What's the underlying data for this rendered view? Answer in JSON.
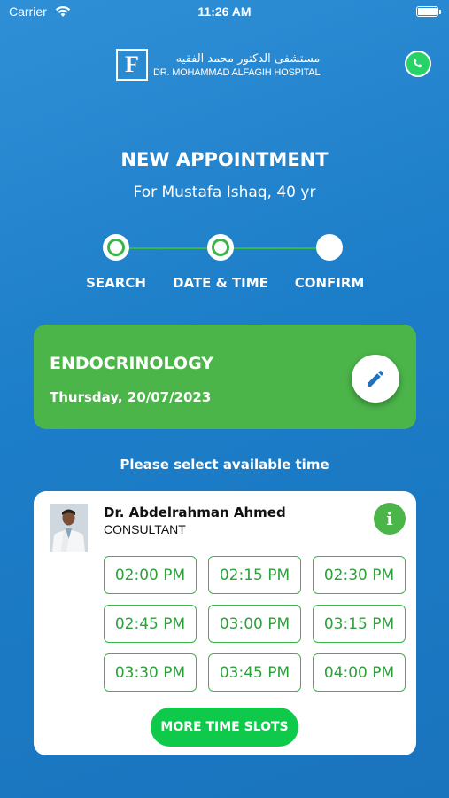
{
  "status_bar": {
    "carrier": "Carrier",
    "time": "11:26 AM"
  },
  "header": {
    "logo_arabic": "مستشفى الدكتور محمد الفقيه",
    "logo_english": "DR. MOHAMMAD ALFAGIH HOSPITAL",
    "logo_letter": "F"
  },
  "page": {
    "title": "NEW APPOINTMENT",
    "subtitle": "For Mustafa Ishaq, 40 yr"
  },
  "stepper": {
    "steps": [
      {
        "label": "SEARCH",
        "done": true
      },
      {
        "label": "DATE & TIME",
        "done": true
      },
      {
        "label": "CONFIRM",
        "done": false
      }
    ]
  },
  "specialty": {
    "name": "ENDOCRINOLOGY",
    "date": "Thursday, 20/07/2023"
  },
  "select_time_label": "Please select available time",
  "doctor": {
    "name": "Dr. Abdelrahman Ahmed",
    "title": "CONSULTANT",
    "info_glyph": "i",
    "slots": [
      "02:00 PM",
      "02:15 PM",
      "02:30 PM",
      "02:45 PM",
      "03:00 PM",
      "03:15 PM",
      "03:30 PM",
      "03:45 PM",
      "04:00 PM"
    ],
    "more_label": "MORE TIME SLOTS"
  },
  "colors": {
    "background": "#1f80cb",
    "accent_green": "#4cb54a",
    "slot_green": "#2f9f3c",
    "button_green": "#0fc94a"
  }
}
